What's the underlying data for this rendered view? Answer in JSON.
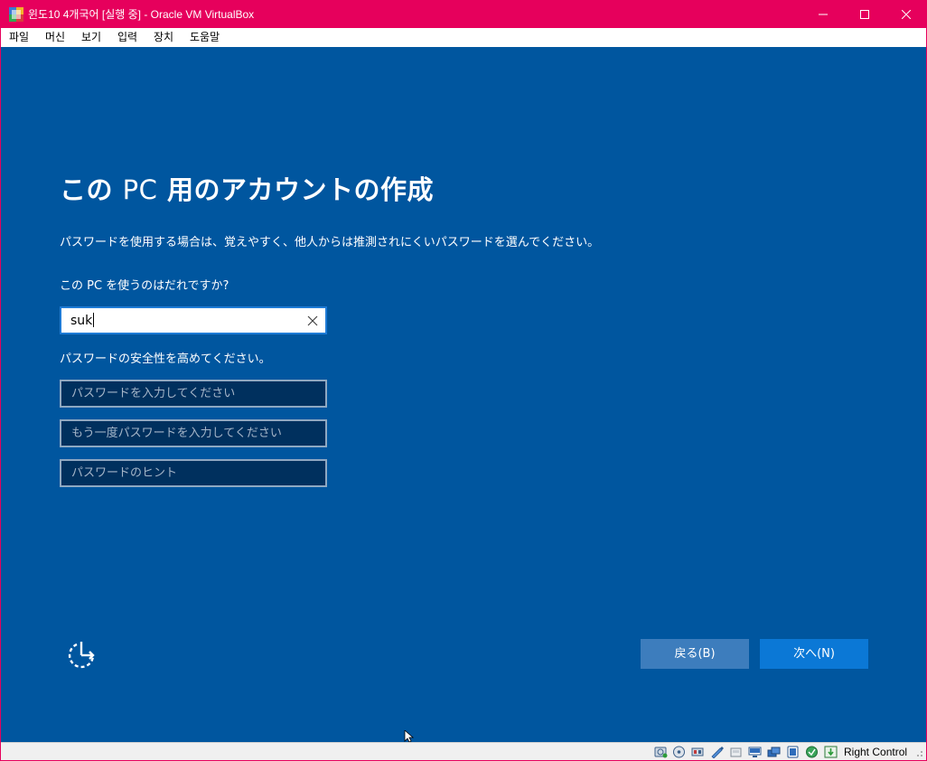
{
  "window": {
    "title": "윈도10 4개국어 [실행 중] - Oracle VM VirtualBox",
    "menu": [
      "파일",
      "머신",
      "보기",
      "입력",
      "장치",
      "도움말"
    ]
  },
  "setup": {
    "heading_pre": "この ",
    "heading_pc": "PC",
    "heading_post": " 用のアカウントの作成",
    "subtitle": "パスワードを使用する場合は、覚えやすく、他人からは推測されにくいパスワードを選んでください。",
    "question": "この PC を使うのはだれですか?",
    "username_value": "suk",
    "password_section_label": "パスワードの安全性を高めてください。",
    "password_placeholder": "パスワードを入力してください",
    "confirm_placeholder": "もう一度パスワードを入力してください",
    "hint_placeholder": "パスワードのヒント",
    "back_label": "戻る(B)",
    "next_label": "次へ(N)"
  },
  "statusbar": {
    "host_key": "Right Control",
    "icons": [
      "hard-disk-icon",
      "optical-drive-icon",
      "audio-icon",
      "network-icon",
      "usb-icon",
      "shared-folders-icon",
      "display-icon",
      "video-capture-icon",
      "recording-icon",
      "cpu-icon",
      "mouse-integration-icon"
    ]
  },
  "colors": {
    "frame": "#e6005c",
    "guest_background": "#00569f",
    "next_button": "#0b78d6",
    "back_button": "#3d7dbd"
  }
}
